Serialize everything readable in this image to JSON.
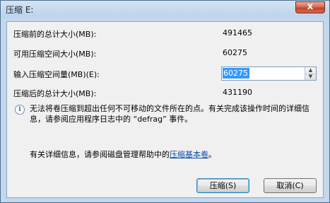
{
  "window": {
    "title": "压缩 E:",
    "close_label": "x"
  },
  "fields": {
    "total_before_label": "压缩前的总计大小(MB):",
    "total_before_value": "491465",
    "available_label": "可用压缩空间大小(MB):",
    "available_value": "60275",
    "input_label": "输入压缩空间量(MB)(E):",
    "input_value": "60275",
    "total_after_label": "压缩后的总计大小(MB):",
    "total_after_value": "431190"
  },
  "info": {
    "icon": "info-icon",
    "text": "无法将卷压缩到超出任何不可移动的文件所在的点。有关完成该操作时间的详细信息，请参阅应用程序日志中的 “defrag” 事件。"
  },
  "detail": {
    "prefix": "有关详细信息，请参阅磁盘管理帮助中的",
    "link": "压缩基本卷",
    "suffix": "。"
  },
  "buttons": {
    "shrink": "压缩(S)",
    "cancel": "取消(C)"
  }
}
